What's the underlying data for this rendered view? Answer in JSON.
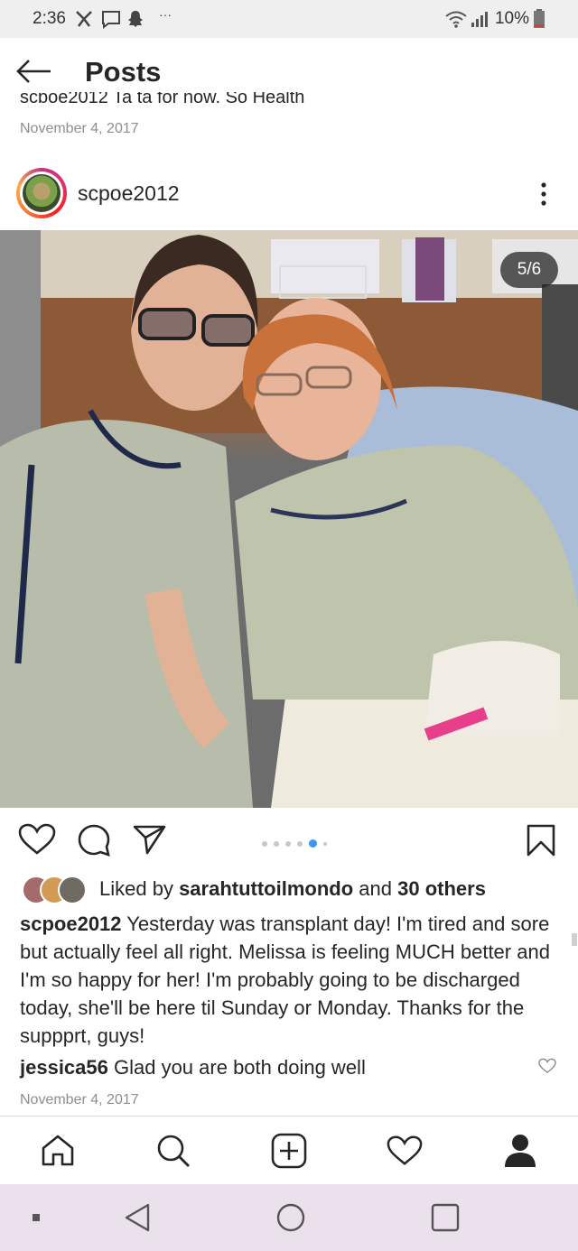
{
  "status_bar": {
    "time": "2:36",
    "battery": "10%"
  },
  "header": {
    "title": "Posts"
  },
  "previous_post": {
    "caption_fragment": "scpoe2012 Ta ta for now, So Health",
    "date": "November 4, 2017"
  },
  "post": {
    "username": "scpoe2012",
    "counter": "5/6",
    "carousel": {
      "count": 6,
      "active_index": 4
    },
    "likes": {
      "prefix": "Liked by ",
      "user": "sarahtuttoilmondo",
      "middle": " and ",
      "others": "30 others"
    },
    "caption": {
      "username": "scpoe2012",
      "text": " Yesterday was transplant day! I'm tired and sore but actually feel all right. Melissa is feeling MUCH better and I'm so happy for her! I'm probably going to be discharged today, she'll be here til Sunday or Monday. Thanks for the suppprt, guys!"
    },
    "comment": {
      "username": "jessica56",
      "text": " Glad you are both doing well"
    },
    "date": "November 4, 2017"
  },
  "icons": {
    "back": "arrow-left-icon",
    "more": "more-vertical-icon",
    "like": "heart-icon",
    "comment": "comment-icon",
    "share": "send-icon",
    "save": "bookmark-icon",
    "nav": [
      "home-icon",
      "search-icon",
      "add-icon",
      "activity-heart-icon",
      "profile-icon"
    ]
  },
  "colors": {
    "accent_blue": "#3897f0",
    "text": "#262626",
    "secondary": "#8e8e8e"
  }
}
